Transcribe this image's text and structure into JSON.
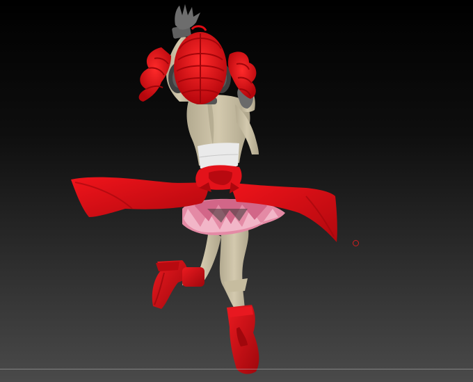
{
  "viewport": {
    "background_top": "#000000",
    "background_bottom": "#4a4a4a"
  },
  "model": {
    "subject": "3d-character-model-back-view",
    "colors": {
      "hair": "#e00a12",
      "skin": "#c9bfa5",
      "top": "#e8e8e8",
      "ribbon": "#d80c12",
      "skirt_pink": "#e58aa6",
      "boots": "#cf0d14",
      "gloves": "#6d6d6d"
    }
  },
  "cursor": {
    "icon": "brush-circle-cursor",
    "color": "#d21e1e"
  }
}
